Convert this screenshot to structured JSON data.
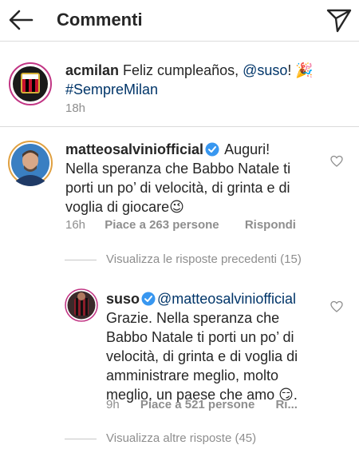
{
  "header": {
    "title": "Commenti"
  },
  "caption": {
    "username": "acmilan",
    "text": " Feliz cumpleaños, ",
    "mention": "@suso",
    "text_after_mention": "! 🎉",
    "hashtag": "#SempreMilan",
    "time": "18h"
  },
  "comments": [
    {
      "username": "matteosalviniofficial",
      "first_line_text": " Auguri!",
      "lines": [
        "Nella speranza che Babbo Natale ti",
        "porti un po’ di velocità, di grinta e di",
        "voglia di giocare😉"
      ],
      "time": "16h",
      "likes": "Piace a 263 persone",
      "reply": "Rispondi",
      "view_replies": "Visualizza le risposte precedenti (15)"
    },
    {
      "username": "suso",
      "mention": "@matteosalviniofficial",
      "lines": [
        "Grazie. Nella speranza che",
        "Babbo Natale ti porti un po’ di",
        "velocità, di grinta e di voglia di",
        "amministrare meglio, molto",
        "meglio, un paese che amo 😏."
      ],
      "time": "9h",
      "likes": "Piace a 521 persone",
      "reply": "Ri...",
      "view_more": "Visualizza altre risposte (45)"
    }
  ],
  "colors": {
    "link": "#003569",
    "verified": "#3897f0",
    "muted": "#8e8e8e"
  }
}
